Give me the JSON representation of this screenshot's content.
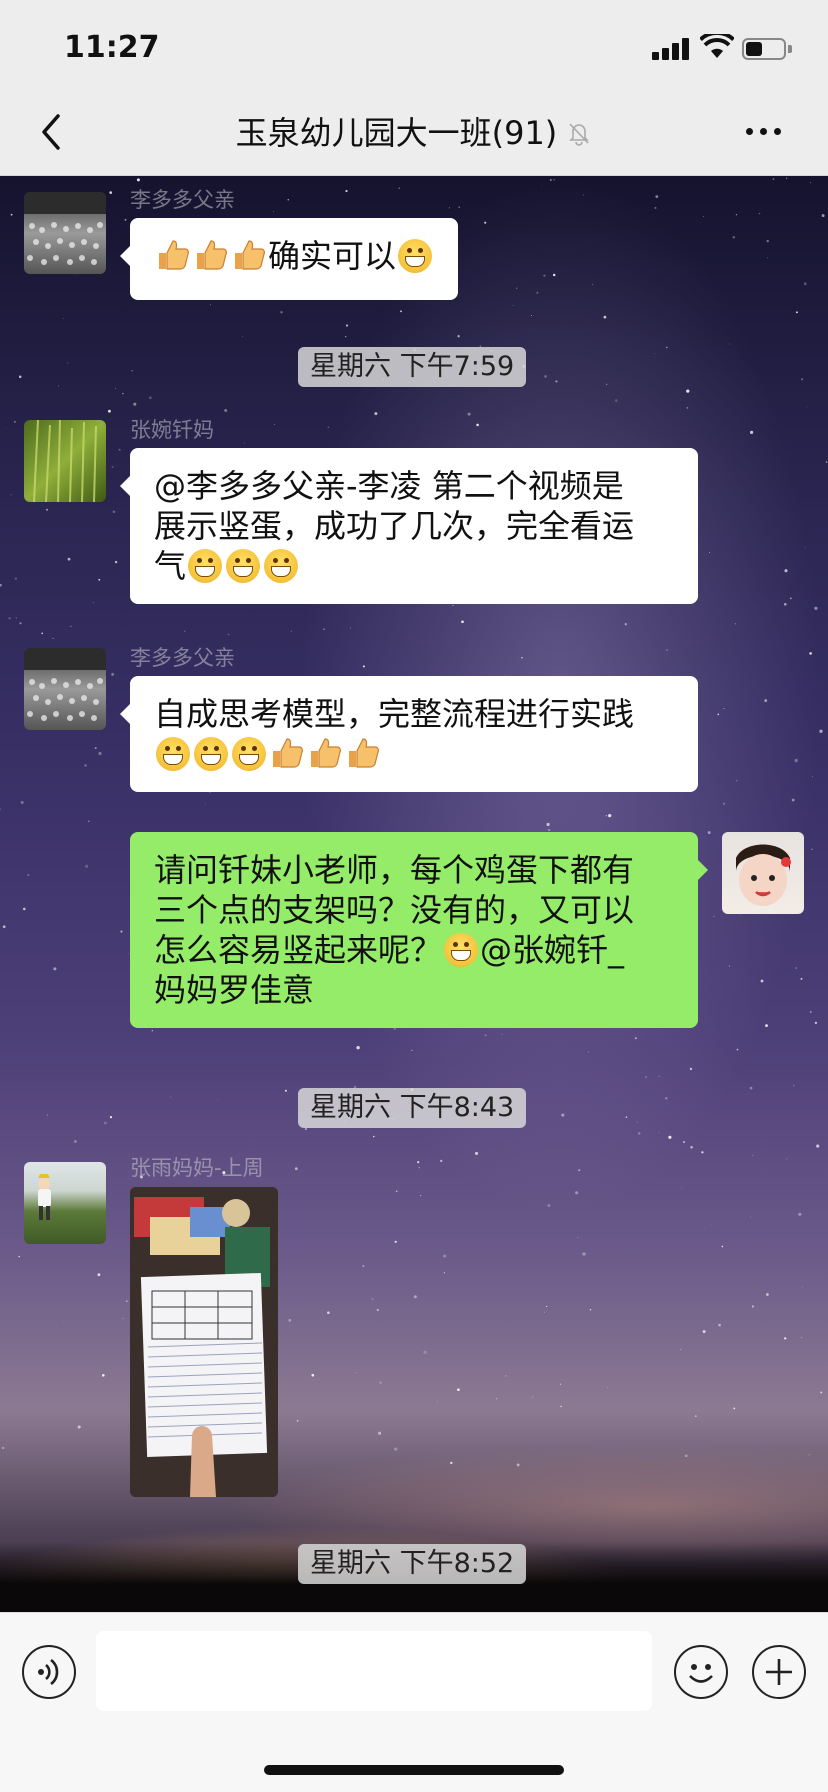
{
  "status_bar": {
    "time": "11:27",
    "battery_level": 0.45
  },
  "header": {
    "title": "玉泉幼儿园大一班(91)",
    "muted": true
  },
  "messages": [
    {
      "id": "m1",
      "side": "left",
      "sender": "李多多父亲",
      "parts": [
        "thumb",
        "thumb",
        "thumb",
        "确实可以",
        "emoji"
      ]
    },
    {
      "id": "t1",
      "type": "timestamp",
      "text": "星期六 下午7:59"
    },
    {
      "id": "m2",
      "side": "left",
      "sender": "张婉钎妈",
      "text_line1": "@李多多父亲-李凌 第二个视频是",
      "text_line2": "展示竖蛋，成功了几次，完全看运",
      "text_line3": "气"
    },
    {
      "id": "m3",
      "side": "left",
      "sender": "李多多父亲",
      "text_line1": "自成思考模型，完整流程进行实践"
    },
    {
      "id": "m4",
      "side": "right",
      "text_line1": "请问钎妹小老师，每个鸡蛋下都有",
      "text_line2": "三个点的支架吗？没有的，又可以",
      "text_line3_a": "怎么容易竖起来呢？",
      "text_line3_b": "@张婉钎_",
      "text_line4": "妈妈罗佳意"
    },
    {
      "id": "t2",
      "type": "timestamp",
      "text": "星期六 下午8:43"
    },
    {
      "id": "m5",
      "side": "left",
      "sender": "张雨妈妈-上周",
      "type": "image"
    },
    {
      "id": "t3",
      "type": "timestamp",
      "text": "星期六 下午8:52"
    }
  ],
  "icons": {
    "back": "chevron-left-icon",
    "mute": "bell-slash-icon",
    "more": "more-dots-icon",
    "voice": "voice-icon",
    "emoji": "emoji-icon",
    "plus": "plus-icon"
  },
  "colors": {
    "bubble_out": "#95ec69",
    "bubble_in": "#ffffff",
    "bar": "#ededed"
  }
}
